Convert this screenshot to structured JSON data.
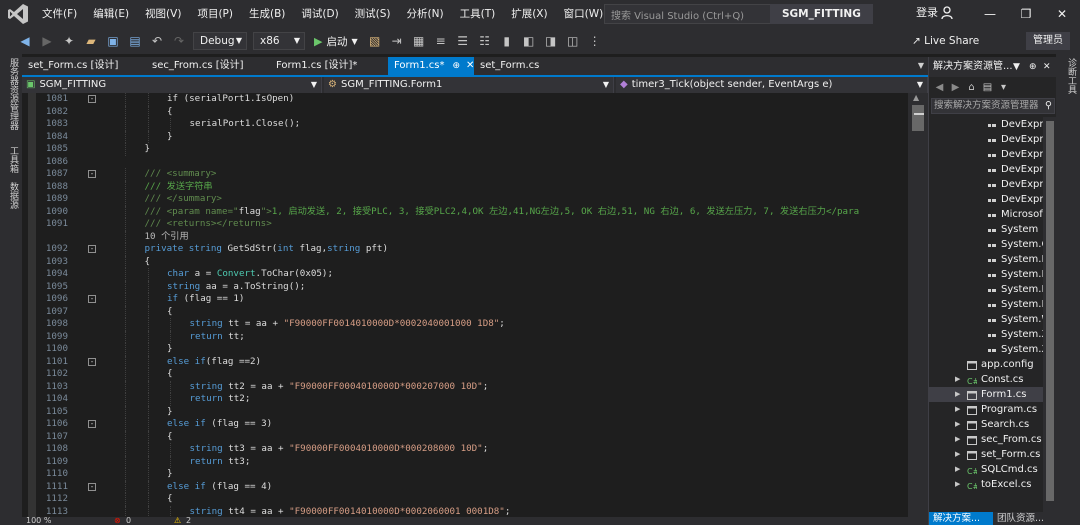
{
  "menu": {
    "items": [
      "文件(F)",
      "编辑(E)",
      "视图(V)",
      "项目(P)",
      "生成(B)",
      "调试(D)",
      "测试(S)",
      "分析(N)",
      "工具(T)",
      "扩展(X)",
      "窗口(W)",
      "帮助(H)"
    ],
    "quick_launch_placeholder": "搜索 Visual Studio (Ctrl+Q)",
    "solution_name": "SGM_FITTING",
    "login": "登录"
  },
  "toolbar": {
    "config": "Debug",
    "platform": "x86",
    "start_label": "启动",
    "live_share": "Live Share",
    "admin": "管理员"
  },
  "left_strip": {
    "items": [
      "服务器资源管理器",
      "工具箱",
      "数据源"
    ]
  },
  "doc_tabs": [
    {
      "label": "set_Form.cs [设计]",
      "active": false
    },
    {
      "label": "sec_From.cs [设计]",
      "active": false
    },
    {
      "label": "Form1.cs [设计]*",
      "active": false
    },
    {
      "label": "Form1.cs*",
      "active": true
    },
    {
      "label": "set_Form.cs",
      "active": false
    }
  ],
  "nav": {
    "project": "SGM_FITTING",
    "class": "SGM_FITTING.Form1",
    "member": "timer3_Tick(object sender, EventArgs e)"
  },
  "code": {
    "lines": [
      {
        "n": "1081",
        "fold": "-",
        "indent": 2,
        "spans": [
          {
            "t": "if (serialPort1.IsOpen)",
            "c": "pl"
          }
        ]
      },
      {
        "n": "1082",
        "fold": "",
        "indent": 2,
        "spans": [
          {
            "t": "{",
            "c": "pl"
          }
        ]
      },
      {
        "n": "1083",
        "fold": "",
        "indent": 3,
        "spans": [
          {
            "t": "serialPort1.Close();",
            "c": "pl"
          }
        ]
      },
      {
        "n": "1084",
        "fold": "",
        "indent": 2,
        "spans": [
          {
            "t": "}",
            "c": "pl"
          }
        ]
      },
      {
        "n": "1085",
        "fold": "",
        "indent": 1,
        "spans": [
          {
            "t": "}",
            "c": "pl"
          }
        ]
      },
      {
        "n": "1086",
        "fold": "",
        "indent": 0,
        "spans": []
      },
      {
        "n": "1087",
        "fold": "-",
        "indent": 1,
        "spans": [
          {
            "t": "/// ",
            "c": "xml"
          },
          {
            "t": "<summary>",
            "c": "xml"
          }
        ]
      },
      {
        "n": "1088",
        "fold": "",
        "indent": 1,
        "spans": [
          {
            "t": "/// 发送字符串",
            "c": "cm"
          }
        ]
      },
      {
        "n": "1089",
        "fold": "",
        "indent": 1,
        "spans": [
          {
            "t": "/// ",
            "c": "xml"
          },
          {
            "t": "</summary>",
            "c": "xml"
          }
        ]
      },
      {
        "n": "1090",
        "fold": "",
        "indent": 1,
        "spans": [
          {
            "t": "/// ",
            "c": "xml"
          },
          {
            "t": "<param name=\"",
            "c": "xml"
          },
          {
            "t": "flag",
            "c": "pl"
          },
          {
            "t": "\">",
            "c": "xml"
          },
          {
            "t": "1, 启动发送, 2, 接受PLC, 3, 接受PLC2,4,OK 左边,41,NG左边,5, OK 右边,51, NG 右边, 6, 发送左压力, 7, 发送右压力</para",
            "c": "cm"
          }
        ]
      },
      {
        "n": "1091",
        "fold": "",
        "indent": 1,
        "spans": [
          {
            "t": "/// ",
            "c": "xml"
          },
          {
            "t": "<returns></returns>",
            "c": "xml"
          }
        ]
      },
      {
        "n": "",
        "fold": "",
        "indent": 1,
        "spans": [
          {
            "t": "10 个引用",
            "c": "ref"
          }
        ]
      },
      {
        "n": "1092",
        "fold": "-",
        "indent": 1,
        "spans": [
          {
            "t": "private ",
            "c": "kw"
          },
          {
            "t": "string ",
            "c": "kw"
          },
          {
            "t": "GetSdStr(",
            "c": "pl"
          },
          {
            "t": "int ",
            "c": "kw"
          },
          {
            "t": "flag,",
            "c": "pl"
          },
          {
            "t": "string ",
            "c": "kw"
          },
          {
            "t": "pft)",
            "c": "pl"
          }
        ]
      },
      {
        "n": "1093",
        "fold": "",
        "indent": 1,
        "spans": [
          {
            "t": "{",
            "c": "pl"
          }
        ]
      },
      {
        "n": "1094",
        "fold": "",
        "indent": 2,
        "spans": [
          {
            "t": "char ",
            "c": "kw"
          },
          {
            "t": "a = ",
            "c": "pl"
          },
          {
            "t": "Convert",
            "c": "ty"
          },
          {
            "t": ".ToChar(0x05);",
            "c": "pl"
          }
        ]
      },
      {
        "n": "1095",
        "fold": "",
        "indent": 2,
        "spans": [
          {
            "t": "string ",
            "c": "kw"
          },
          {
            "t": "aa = a.ToString();",
            "c": "pl"
          }
        ]
      },
      {
        "n": "1096",
        "fold": "-",
        "indent": 2,
        "spans": [
          {
            "t": "if ",
            "c": "kw"
          },
          {
            "t": "(flag == 1)",
            "c": "pl"
          }
        ]
      },
      {
        "n": "1097",
        "fold": "",
        "indent": 2,
        "spans": [
          {
            "t": "{",
            "c": "pl"
          }
        ]
      },
      {
        "n": "1098",
        "fold": "",
        "indent": 3,
        "spans": [
          {
            "t": "string ",
            "c": "kw"
          },
          {
            "t": "tt = aa + ",
            "c": "pl"
          },
          {
            "t": "\"F90000FF0014010000D*0002040001000 1D8\"",
            "c": "str"
          },
          {
            "t": ";",
            "c": "pl"
          }
        ]
      },
      {
        "n": "1099",
        "fold": "",
        "indent": 3,
        "spans": [
          {
            "t": "return ",
            "c": "kw"
          },
          {
            "t": "tt;",
            "c": "pl"
          }
        ]
      },
      {
        "n": "1100",
        "fold": "",
        "indent": 2,
        "spans": [
          {
            "t": "}",
            "c": "pl"
          }
        ]
      },
      {
        "n": "1101",
        "fold": "-",
        "indent": 2,
        "spans": [
          {
            "t": "else ",
            "c": "kw"
          },
          {
            "t": "if",
            "c": "kw"
          },
          {
            "t": "(flag ==2)",
            "c": "pl"
          }
        ]
      },
      {
        "n": "1102",
        "fold": "",
        "indent": 2,
        "spans": [
          {
            "t": "{",
            "c": "pl"
          }
        ]
      },
      {
        "n": "1103",
        "fold": "",
        "indent": 3,
        "spans": [
          {
            "t": "string ",
            "c": "kw"
          },
          {
            "t": "tt2 = aa + ",
            "c": "pl"
          },
          {
            "t": "\"F90000FF0004010000D*000207000 10D\"",
            "c": "str"
          },
          {
            "t": ";",
            "c": "pl"
          }
        ]
      },
      {
        "n": "1104",
        "fold": "",
        "indent": 3,
        "spans": [
          {
            "t": "return ",
            "c": "kw"
          },
          {
            "t": "tt2;",
            "c": "pl"
          }
        ]
      },
      {
        "n": "1105",
        "fold": "",
        "indent": 2,
        "spans": [
          {
            "t": "}",
            "c": "pl"
          }
        ]
      },
      {
        "n": "1106",
        "fold": "-",
        "indent": 2,
        "spans": [
          {
            "t": "else ",
            "c": "kw"
          },
          {
            "t": "if ",
            "c": "kw"
          },
          {
            "t": "(flag == 3)",
            "c": "pl"
          }
        ]
      },
      {
        "n": "1107",
        "fold": "",
        "indent": 2,
        "spans": [
          {
            "t": "{",
            "c": "pl"
          }
        ]
      },
      {
        "n": "1108",
        "fold": "",
        "indent": 3,
        "spans": [
          {
            "t": "string ",
            "c": "kw"
          },
          {
            "t": "tt3 = aa + ",
            "c": "pl"
          },
          {
            "t": "\"F90000FF0004010000D*000208000 10D\"",
            "c": "str"
          },
          {
            "t": ";",
            "c": "pl"
          }
        ]
      },
      {
        "n": "1109",
        "fold": "",
        "indent": 3,
        "spans": [
          {
            "t": "return ",
            "c": "kw"
          },
          {
            "t": "tt3;",
            "c": "pl"
          }
        ]
      },
      {
        "n": "1110",
        "fold": "",
        "indent": 2,
        "spans": [
          {
            "t": "}",
            "c": "pl"
          }
        ]
      },
      {
        "n": "1111",
        "fold": "-",
        "indent": 2,
        "spans": [
          {
            "t": "else ",
            "c": "kw"
          },
          {
            "t": "if ",
            "c": "kw"
          },
          {
            "t": "(flag == 4)",
            "c": "pl"
          }
        ]
      },
      {
        "n": "1112",
        "fold": "",
        "indent": 2,
        "spans": [
          {
            "t": "{",
            "c": "pl"
          }
        ]
      },
      {
        "n": "1113",
        "fold": "",
        "indent": 3,
        "spans": [
          {
            "t": "string ",
            "c": "kw"
          },
          {
            "t": "tt4 = aa + ",
            "c": "pl"
          },
          {
            "t": "\"F90000FF0014010000D*0002060001 0001D8\"",
            "c": "str"
          },
          {
            "t": ";",
            "c": "pl"
          }
        ]
      }
    ]
  },
  "status": {
    "zoom": "100 %",
    "errors": "0",
    "warnings": "2"
  },
  "solution_explorer": {
    "title": "解决方案资源管...",
    "search_placeholder": "搜索解决方案资源管理器",
    "items": [
      {
        "label": "DevExpre",
        "kind": "ref",
        "indent": 4,
        "expand": ""
      },
      {
        "label": "DevExpre",
        "kind": "ref",
        "indent": 4,
        "expand": ""
      },
      {
        "label": "DevExpre",
        "kind": "ref",
        "indent": 4,
        "expand": ""
      },
      {
        "label": "DevExpre",
        "kind": "ref",
        "indent": 4,
        "expand": ""
      },
      {
        "label": "DevExpre",
        "kind": "ref",
        "indent": 4,
        "expand": ""
      },
      {
        "label": "DevExpre",
        "kind": "ref",
        "indent": 4,
        "expand": ""
      },
      {
        "label": "Microsof",
        "kind": "ref",
        "indent": 4,
        "expand": ""
      },
      {
        "label": "System",
        "kind": "ref",
        "indent": 4,
        "expand": ""
      },
      {
        "label": "System.C",
        "kind": "ref",
        "indent": 4,
        "expand": ""
      },
      {
        "label": "System.D",
        "kind": "ref",
        "indent": 4,
        "expand": ""
      },
      {
        "label": "System.D",
        "kind": "ref",
        "indent": 4,
        "expand": ""
      },
      {
        "label": "System.D",
        "kind": "ref",
        "indent": 4,
        "expand": ""
      },
      {
        "label": "System.D",
        "kind": "ref",
        "indent": 4,
        "expand": ""
      },
      {
        "label": "System.W",
        "kind": "ref",
        "indent": 4,
        "expand": ""
      },
      {
        "label": "System.X",
        "kind": "ref",
        "indent": 4,
        "expand": ""
      },
      {
        "label": "System.X",
        "kind": "ref",
        "indent": 4,
        "expand": ""
      },
      {
        "label": "app.config",
        "kind": "config",
        "indent": 2,
        "expand": ""
      },
      {
        "label": "Const.cs",
        "kind": "cs",
        "indent": 2,
        "expand": "▶"
      },
      {
        "label": "Form1.cs",
        "kind": "form",
        "indent": 2,
        "expand": "▶",
        "selected": true
      },
      {
        "label": "Program.cs",
        "kind": "form",
        "indent": 2,
        "expand": "▶"
      },
      {
        "label": "Search.cs",
        "kind": "form",
        "indent": 2,
        "expand": "▶"
      },
      {
        "label": "sec_From.cs",
        "kind": "form",
        "indent": 2,
        "expand": "▶"
      },
      {
        "label": "set_Form.cs",
        "kind": "form",
        "indent": 2,
        "expand": "▶"
      },
      {
        "label": "SQLCmd.cs",
        "kind": "cs",
        "indent": 2,
        "expand": "▶"
      },
      {
        "label": "toExcel.cs",
        "kind": "cs",
        "indent": 2,
        "expand": "▶"
      }
    ],
    "bottom_tabs": [
      "解决方案...",
      "团队资源..."
    ]
  },
  "right_strip": {
    "items": [
      "诊断工具"
    ]
  },
  "colors": {
    "accent": "#007acc",
    "background": "#1e1e1e",
    "chrome": "#2d2d30"
  }
}
